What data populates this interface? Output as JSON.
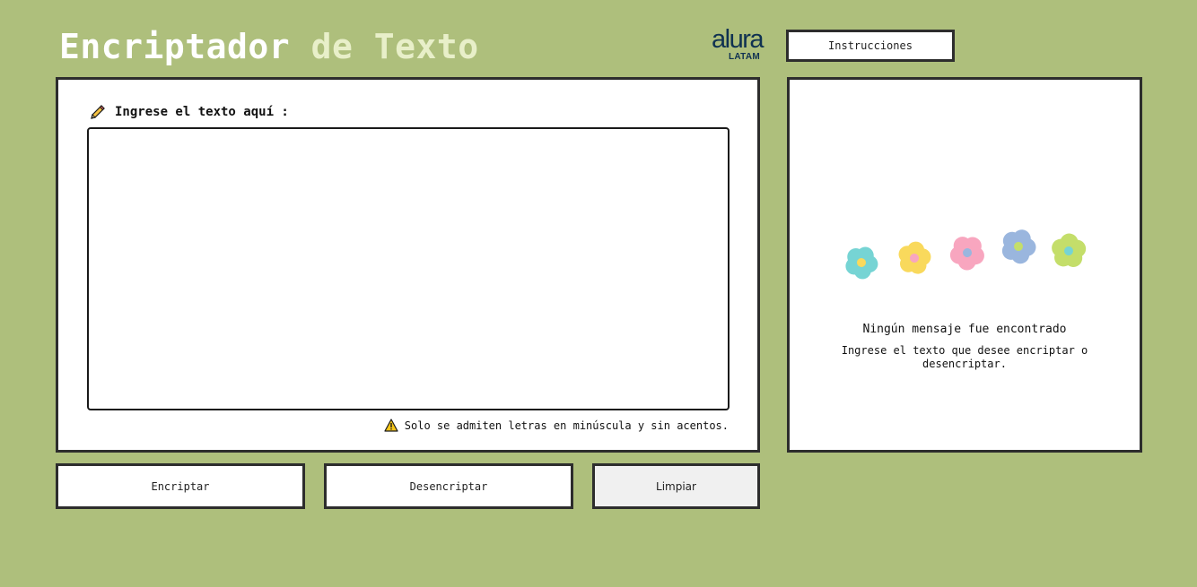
{
  "header": {
    "title_part1": "Encriptador",
    "title_part2": "de Texto",
    "logo_word": "alura",
    "logo_sub": "LATAM",
    "instructions_label": "Instrucciones"
  },
  "input": {
    "label": "Ingrese el texto aquí :",
    "value": "",
    "placeholder": "",
    "warning": "Solo se admiten letras en minúscula y sin acentos."
  },
  "output": {
    "empty_title": "Ningún mensaje fue encontrado",
    "empty_body": "Ingrese el texto que desee encriptar o desencriptar."
  },
  "actions": {
    "encrypt_label": "Encriptar",
    "decrypt_label": "Desencriptar",
    "clear_label": "Limpiar"
  },
  "colors": {
    "background": "#aebf7c",
    "logo": "#0f3151",
    "border": "#2d2d2d",
    "flower_teal": "#76d4d4",
    "flower_yellow": "#f9d95c",
    "flower_pink": "#f8a6bf",
    "flower_blue": "#9ab6de",
    "flower_green": "#c4de6a"
  },
  "icons": {
    "label_icon": "pencil-icon",
    "warning_icon": "warning-icon",
    "illustration": "flowers-illustration"
  }
}
